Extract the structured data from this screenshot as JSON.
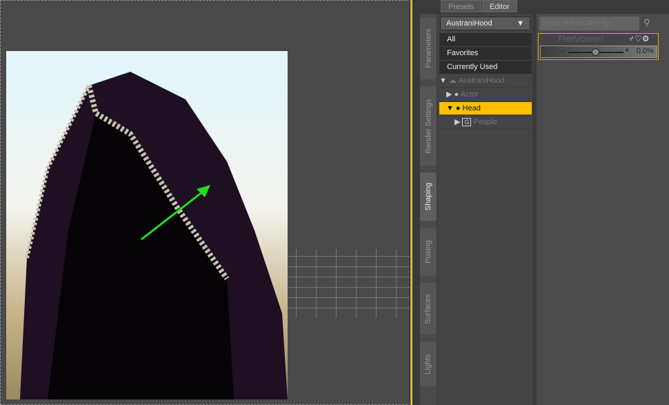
{
  "tabs": {
    "presets": "Presets",
    "editor": "Editor"
  },
  "side_tabs": [
    "Parameters",
    "Render Settings",
    "Shaping",
    "Posing",
    "Surfaces",
    "Lights"
  ],
  "active_side_tab": "Shaping",
  "selector": {
    "value": "AustraniHood"
  },
  "categories": [
    "All",
    "Favorites",
    "Currently Used"
  ],
  "tree": [
    {
      "label": "AustraniHood",
      "icon": "figure-group-icon",
      "expanded": true
    },
    {
      "label": "Actor",
      "icon": "person-icon",
      "expanded": false
    },
    {
      "label": "Head",
      "icon": "person-icon",
      "expanded": true,
      "selected": true
    },
    {
      "label": "People",
      "icon": "group-box-icon",
      "expanded": false
    }
  ],
  "filter": {
    "placeholder": "Enter text to filter by..."
  },
  "property": {
    "name": "FHMVictoria7",
    "value": "0.0%",
    "minus": "-",
    "plus": "+",
    "slider_fraction": 0.5
  },
  "colors": {
    "accent": "#ffc000",
    "arrow": "#22dd22"
  }
}
